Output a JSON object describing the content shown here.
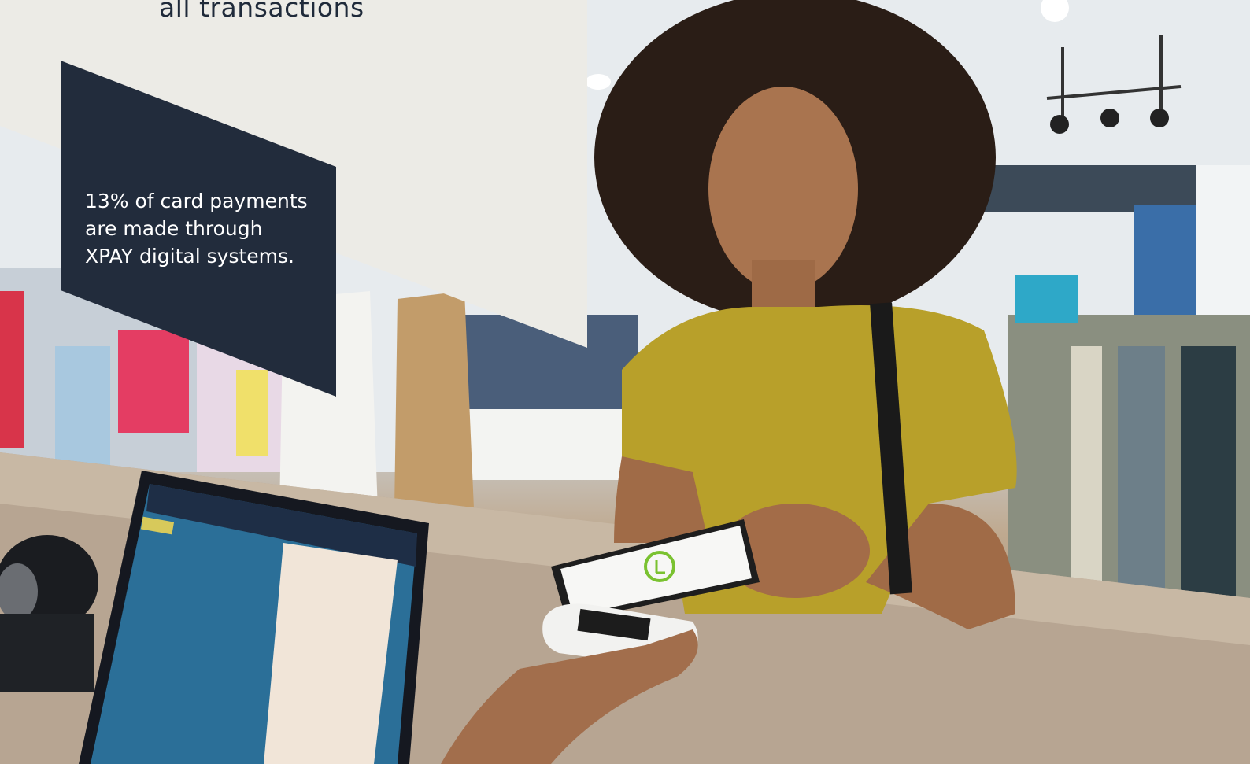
{
  "caption": {
    "line": "all transactions"
  },
  "stat": {
    "lines": [
      "13% of card payments",
      "are made through",
      "XPAY digital systems."
    ]
  },
  "photo": {
    "description_icon": "retail-payment-photo-icon",
    "phone_logo_icon": "payment-app-logo-icon"
  },
  "colors": {
    "panel_bg": "#ecebe6",
    "stat_bg": "#222c3c",
    "text_dark": "#1f2a3a",
    "shirt": "#b8a02a"
  }
}
